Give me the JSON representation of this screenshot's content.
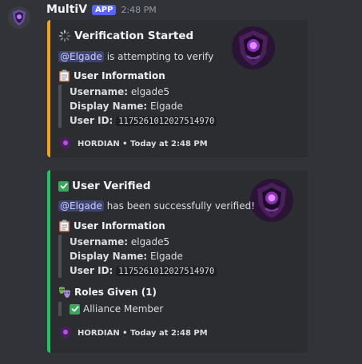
{
  "message": {
    "author": "MultiV",
    "badge": "APP",
    "timestamp": "2:48 PM"
  },
  "colors": {
    "embed1_bar": "#f2a31b",
    "embed2_bar": "#23c45e",
    "mention_bg": "#3d4270",
    "app_badge": "#5865f2"
  },
  "embed1": {
    "title": "Verification Started",
    "mention": "@Elgade",
    "description_rest": " is attempting to verify",
    "field_title": "User Information",
    "username_label": "Username:",
    "username_value": " elgade5",
    "display_label": "Display Name:",
    "display_value": " Elgade",
    "userid_label": "User ID:",
    "userid_value": "1175261012027514970",
    "footer": "HORDIAN • Today at 2:48 PM",
    "title_icon": "loading-spinner-icon"
  },
  "embed2": {
    "title": "User Verified",
    "mention": "@Elgade",
    "description_rest": " has been successfully verified!",
    "field_title": "User Information",
    "username_label": "Username:",
    "username_value": " elgade5",
    "display_label": "Display Name:",
    "display_value": " Elgade",
    "userid_label": "User ID:",
    "userid_value": "1175261012027514970",
    "roles_title": "Roles Given (1)",
    "role_1": "Alliance Member",
    "footer": "HORDIAN • Today at 2:48 PM",
    "title_icon": "check-mark-icon"
  }
}
